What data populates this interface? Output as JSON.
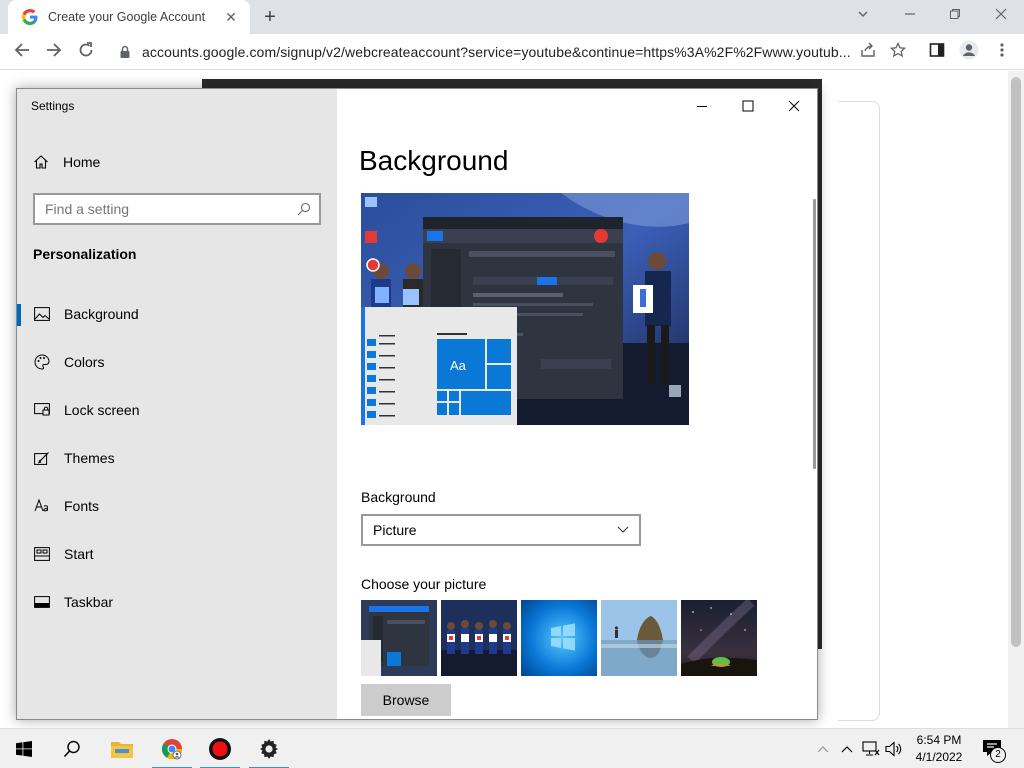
{
  "browser": {
    "tab_title": "Create your Google Account",
    "tab_close": "✕",
    "new_tab": "+",
    "url": "accounts.google.com/signup/v2/webcreateaccount?service=youtube&continue=https%3A%2F%2Fwww.youtub..."
  },
  "settings": {
    "window_title": "Settings",
    "home_label": "Home",
    "search_placeholder": "Find a setting",
    "section_label": "Personalization",
    "nav_items": [
      {
        "label": "Background",
        "icon": "picture-icon"
      },
      {
        "label": "Colors",
        "icon": "palette-icon"
      },
      {
        "label": "Lock screen",
        "icon": "lock-screen-icon"
      },
      {
        "label": "Themes",
        "icon": "themes-icon"
      },
      {
        "label": "Fonts",
        "icon": "fonts-icon"
      },
      {
        "label": "Start",
        "icon": "start-icon"
      },
      {
        "label": "Taskbar",
        "icon": "taskbar-icon"
      }
    ],
    "page_title": "Background",
    "preview_tile_text": "Aa",
    "background_label": "Background",
    "background_value": "Picture",
    "choose_picture_label": "Choose your picture",
    "browse_label": "Browse"
  },
  "taskbar": {
    "time": "6:54 PM",
    "date": "4/1/2022",
    "notification_count": "2"
  },
  "colors": {
    "accent": "#0067c0",
    "tile_blue": "#0a78d7",
    "nav_bg": "#e6e6e6"
  }
}
